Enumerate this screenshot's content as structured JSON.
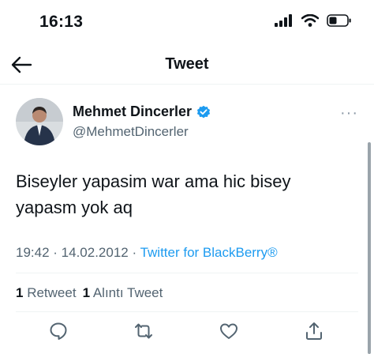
{
  "status": {
    "time": "16:13"
  },
  "nav": {
    "title": "Tweet"
  },
  "tweet": {
    "author_name": "Mehmet Dincerler",
    "author_handle": "@MehmetDincerler",
    "more": "···",
    "text_line1": "Biseyler yapasim war ama hic bisey",
    "text_line2": "yapasm yok aq",
    "time": "19:42",
    "sep1": " · ",
    "date": "14.02.2012",
    "sep2": " · ",
    "source": "Twitter for BlackBerry®"
  },
  "stats": {
    "retweet_count": "1",
    "retweet_label": "Retweet",
    "quote_count": "1",
    "quote_label": "Alıntı Tweet"
  },
  "colors": {
    "accent": "#1d9bf0",
    "text": "#0f1419",
    "muted": "#536471",
    "border": "#eff3f4"
  },
  "icons": [
    "signal-icon",
    "wifi-icon",
    "battery-icon",
    "back-arrow-icon",
    "verified-badge-icon",
    "reply-icon",
    "retweet-icon",
    "like-icon",
    "share-icon"
  ]
}
